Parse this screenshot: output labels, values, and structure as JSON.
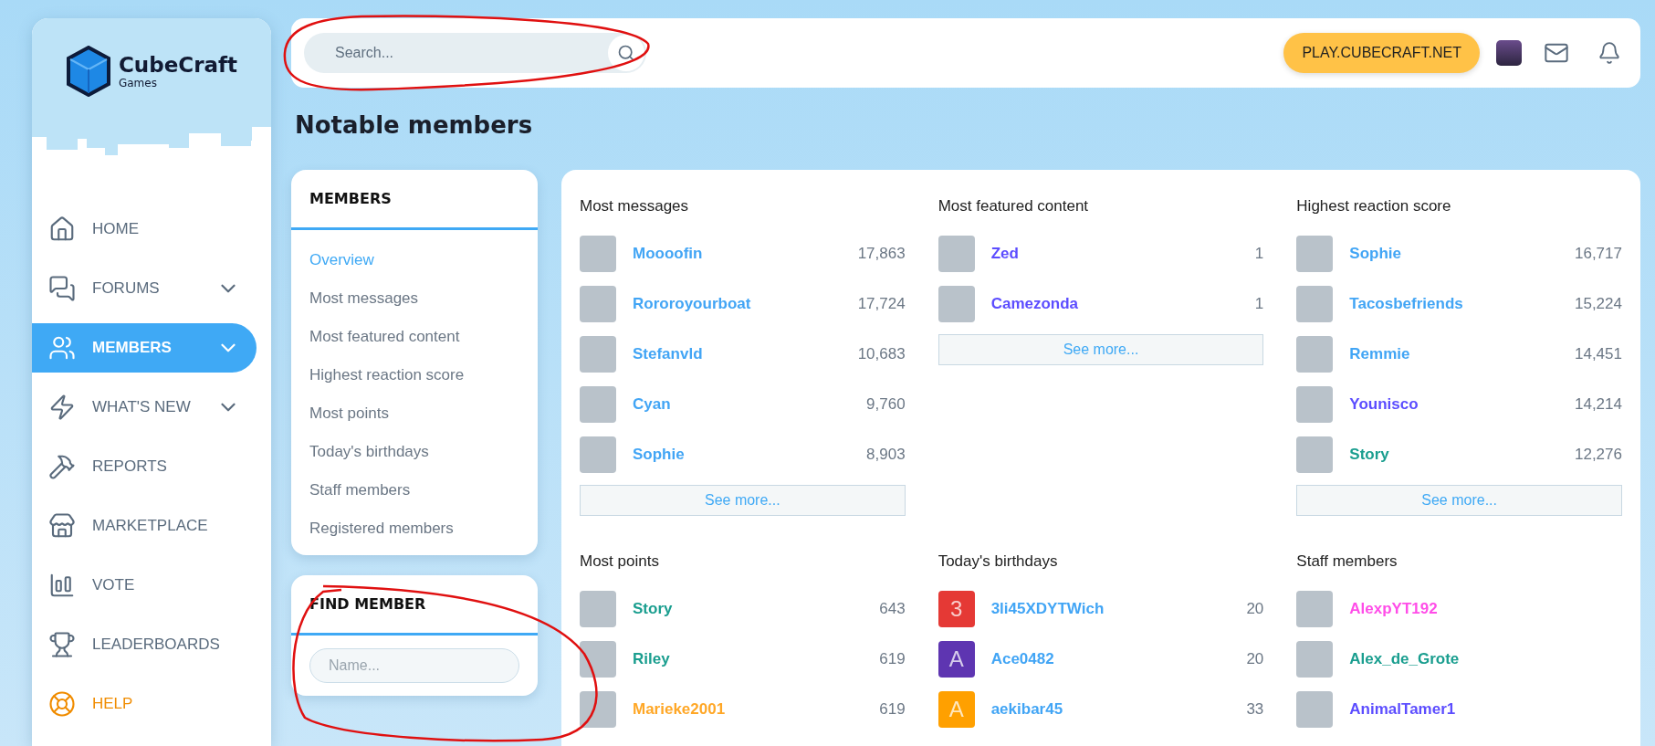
{
  "logo": {
    "name": "CubeCraft",
    "subtitle": "Games"
  },
  "sidebar": {
    "items": [
      {
        "label": "HOME",
        "selected": false,
        "has_submenu": false,
        "accent": false
      },
      {
        "label": "FORUMS",
        "selected": false,
        "has_submenu": true,
        "accent": false
      },
      {
        "label": "MEMBERS",
        "selected": true,
        "has_submenu": true,
        "accent": false
      },
      {
        "label": "WHAT'S NEW",
        "selected": false,
        "has_submenu": true,
        "accent": false
      },
      {
        "label": "REPORTS",
        "selected": false,
        "has_submenu": false,
        "accent": false
      },
      {
        "label": "MARKETPLACE",
        "selected": false,
        "has_submenu": false,
        "accent": false
      },
      {
        "label": "VOTE",
        "selected": false,
        "has_submenu": false,
        "accent": false
      },
      {
        "label": "LEADERBOARDS",
        "selected": false,
        "has_submenu": false,
        "accent": false
      },
      {
        "label": "HELP",
        "selected": false,
        "has_submenu": false,
        "accent": true
      }
    ]
  },
  "header": {
    "search": {
      "placeholder": "Search..."
    },
    "server_button": "PLAY.CUBECRAFT.NET"
  },
  "page_title": "Notable members",
  "members_menu": {
    "title": "MEMBERS",
    "items": [
      {
        "label": "Overview",
        "selected": true
      },
      {
        "label": "Most messages",
        "selected": false
      },
      {
        "label": "Most featured content",
        "selected": false
      },
      {
        "label": "Highest reaction score",
        "selected": false
      },
      {
        "label": "Most points",
        "selected": false
      },
      {
        "label": "Today's birthdays",
        "selected": false
      },
      {
        "label": "Staff members",
        "selected": false
      },
      {
        "label": "Registered members",
        "selected": false
      }
    ]
  },
  "find_member": {
    "title": "FIND MEMBER",
    "placeholder": "Name..."
  },
  "sections": [
    {
      "title": "Most messages",
      "see_more": "See more...",
      "members": [
        {
          "name": "Moooofin",
          "count": "17,863",
          "color": "#42a5f5",
          "avatar": {
            "kind": "photo"
          }
        },
        {
          "name": "Rororoyourboat",
          "count": "17,724",
          "color": "#42a5f5",
          "avatar": {
            "kind": "photo"
          }
        },
        {
          "name": "Stefanvld",
          "count": "10,683",
          "color": "#42a5f5",
          "avatar": {
            "kind": "photo"
          }
        },
        {
          "name": "Cyan",
          "count": "9,760",
          "color": "#42a5f5",
          "avatar": {
            "kind": "photo"
          }
        },
        {
          "name": "Sophie",
          "count": "8,903",
          "color": "#42a5f5",
          "avatar": {
            "kind": "photo"
          }
        }
      ]
    },
    {
      "title": "Most featured content",
      "see_more": "See more...",
      "members": [
        {
          "name": "Zed",
          "count": "1",
          "color": "#5c4dff",
          "avatar": {
            "kind": "photo"
          }
        },
        {
          "name": "Camezonda",
          "count": "1",
          "color": "#5c4dff",
          "avatar": {
            "kind": "photo"
          }
        }
      ]
    },
    {
      "title": "Highest reaction score",
      "see_more": "See more...",
      "members": [
        {
          "name": "Sophie",
          "count": "16,717",
          "color": "#42a5f5",
          "avatar": {
            "kind": "photo"
          }
        },
        {
          "name": "Tacosbefriends",
          "count": "15,224",
          "color": "#42a5f5",
          "avatar": {
            "kind": "photo"
          }
        },
        {
          "name": "Remmie",
          "count": "14,451",
          "color": "#42a5f5",
          "avatar": {
            "kind": "photo"
          }
        },
        {
          "name": "Younisco",
          "count": "14,214",
          "color": "#5c4dff",
          "avatar": {
            "kind": "photo"
          }
        },
        {
          "name": "Story",
          "count": "12,276",
          "color": "#1a9e8f",
          "avatar": {
            "kind": "photo"
          }
        }
      ]
    },
    {
      "title": "Most points",
      "members": [
        {
          "name": "Story",
          "count": "643",
          "color": "#1a9e8f",
          "avatar": {
            "kind": "photo"
          }
        },
        {
          "name": "Riley",
          "count": "619",
          "color": "#1a9e8f",
          "avatar": {
            "kind": "photo"
          }
        },
        {
          "name": "Marieke2001",
          "count": "619",
          "color": "#ffa726",
          "avatar": {
            "kind": "photo"
          }
        }
      ]
    },
    {
      "title": "Today's birthdays",
      "members": [
        {
          "name": "3li45XDYTWich",
          "count": "20",
          "color": "#42a5f5",
          "avatar": {
            "kind": "letter",
            "letter": "3",
            "color": "#e53935"
          }
        },
        {
          "name": "Ace0482",
          "count": "20",
          "color": "#42a5f5",
          "avatar": {
            "kind": "letter",
            "letter": "A",
            "color": "#5e35b1"
          }
        },
        {
          "name": "aekibar45",
          "count": "33",
          "color": "#42a5f5",
          "avatar": {
            "kind": "letter",
            "letter": "A",
            "color": "#ffa000"
          }
        }
      ]
    },
    {
      "title": "Staff members",
      "members": [
        {
          "name": "AlexpYT192",
          "color": "#ff4de8",
          "avatar": {
            "kind": "photo"
          }
        },
        {
          "name": "Alex_de_Grote",
          "color": "#1a9e8f",
          "avatar": {
            "kind": "photo"
          }
        },
        {
          "name": "AnimalTamer1",
          "color": "#5c4dff",
          "avatar": {
            "kind": "photo"
          }
        }
      ]
    }
  ]
}
